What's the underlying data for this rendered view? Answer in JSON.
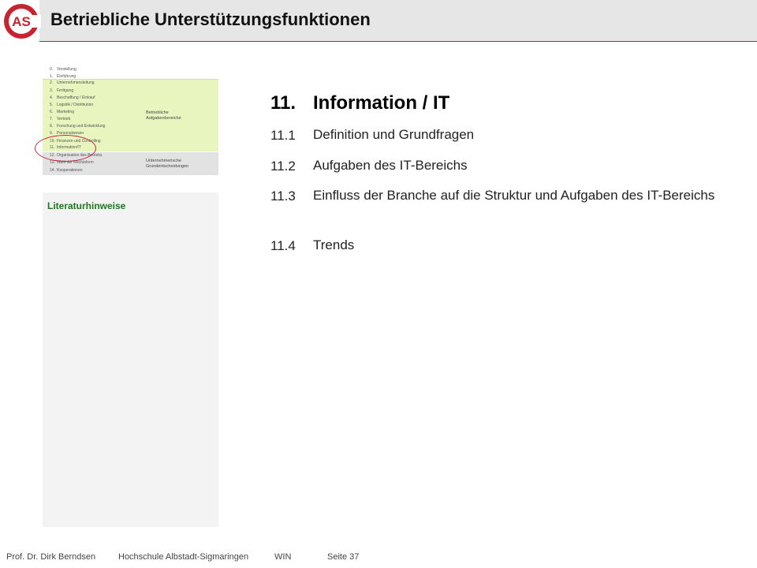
{
  "header": {
    "title": "Betriebliche Unterstützungsfunktionen"
  },
  "logo": {
    "text": "AS",
    "color": "#c8242f"
  },
  "nav": {
    "items": [
      {
        "num": "0.",
        "label": "Vorstellung"
      },
      {
        "num": "1.",
        "label": "Einführung"
      },
      {
        "num": "2.",
        "label": "Unternehmensleitung"
      },
      {
        "num": "3.",
        "label": "Fertigung"
      },
      {
        "num": "4.",
        "label": "Beschaffung / Einkauf"
      },
      {
        "num": "5.",
        "label": "Logistik / Distribution"
      },
      {
        "num": "6.",
        "label": "Marketing"
      },
      {
        "num": "7.",
        "label": "Vertrieb"
      },
      {
        "num": "8.",
        "label": "Forschung und Entwicklung"
      },
      {
        "num": "9.",
        "label": "Personalwesen"
      },
      {
        "num": "10.",
        "label": "Finanzen und Controlling"
      },
      {
        "num": "11.",
        "label": "Information/IT"
      },
      {
        "num": "12.",
        "label": "Organisation des Betriebs"
      },
      {
        "num": "13.",
        "label": "Wahl der Rechtsform"
      },
      {
        "num": "14.",
        "label": "Kooperationen"
      }
    ],
    "group1": [
      "Betriebliche",
      "Aufgabenbereiche"
    ],
    "group2": [
      "Unternehmerische",
      "Grundentscheidungen"
    ]
  },
  "literature": {
    "title": "Literaturhinweise"
  },
  "chapter": {
    "number": "11.",
    "title": "Information / IT"
  },
  "sections": [
    {
      "num": "11.1",
      "title": "Definition und Grundfragen"
    },
    {
      "num": "11.2",
      "title": "Aufgaben des IT-Bereichs"
    },
    {
      "num": "11.3",
      "title": "Einfluss der Branche auf die Struktur und Aufgaben des IT-Bereichs"
    },
    {
      "num": "11.4",
      "title": "Trends"
    }
  ],
  "footer": {
    "author": "Prof. Dr. Dirk Berndsen",
    "school": "Hochschule Albstadt-Sigmaringen",
    "program": "WIN",
    "page": "Seite 37"
  },
  "colors": {
    "accent": "#c8242f",
    "green_block": "#e9f5bf",
    "literature_title": "#1a7a1a"
  }
}
